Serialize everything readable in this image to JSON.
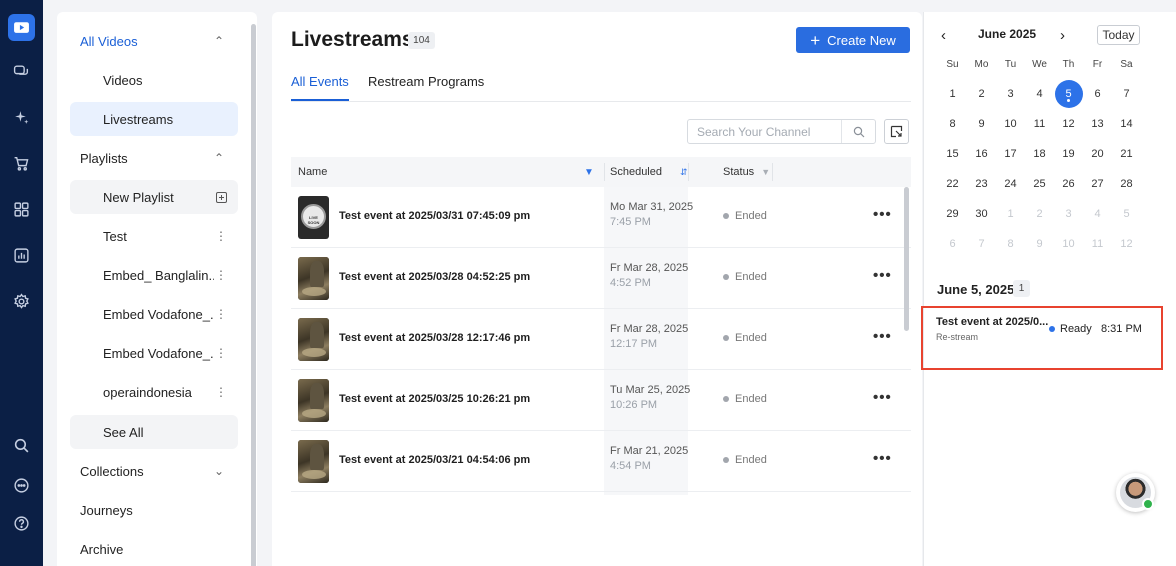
{
  "sidebar": {
    "sections": [
      {
        "label": "All Videos",
        "expanded": true
      },
      {
        "label": "Playlists",
        "expanded": true
      },
      {
        "label": "Collections",
        "expanded": false
      },
      {
        "label": "Journeys"
      },
      {
        "label": "Archive"
      }
    ],
    "video_items": [
      "Videos",
      "Livestreams"
    ],
    "playlist_items": [
      {
        "label": "New Playlist"
      },
      {
        "label": "Test"
      },
      {
        "label": "Embed_ Banglalin..."
      },
      {
        "label": "Embed Vodafone_..."
      },
      {
        "label": "Embed Vodafone_..."
      },
      {
        "label": "operaindonesia"
      },
      {
        "label": "See All"
      }
    ]
  },
  "main": {
    "title": "Livestreams",
    "count": "104",
    "create_label": "Create New",
    "tabs": [
      "All Events",
      "Restream Programs"
    ],
    "search_placeholder": "Search Your Channel",
    "columns": [
      "Name",
      "Scheduled",
      "Status"
    ],
    "rows": [
      {
        "name": "Test event at 2025/03/31 07:45:09 pm",
        "date": "Mo Mar 31, 2025",
        "time": "7:45 PM",
        "status": "Ended",
        "thumb": "live",
        "thumb_text": "LIVE SOON"
      },
      {
        "name": "Test event at 2025/03/28 04:52:25 pm",
        "date": "Fr Mar 28, 2025",
        "time": "4:52 PM",
        "status": "Ended",
        "thumb": "photo"
      },
      {
        "name": "Test event at 2025/03/28 12:17:46 pm",
        "date": "Fr Mar 28, 2025",
        "time": "12:17 PM",
        "status": "Ended",
        "thumb": "photo"
      },
      {
        "name": "Test event at 2025/03/25 10:26:21 pm",
        "date": "Tu Mar 25, 2025",
        "time": "10:26 PM",
        "status": "Ended",
        "thumb": "photo"
      },
      {
        "name": "Test event at 2025/03/21 04:54:06 pm",
        "date": "Fr Mar 21, 2025",
        "time": "4:54 PM",
        "status": "Ended",
        "thumb": "photo"
      }
    ]
  },
  "calendar": {
    "month": "June 2025",
    "today_label": "Today",
    "weekdays": [
      "Su",
      "Mo",
      "Tu",
      "We",
      "Th",
      "Fr",
      "Sa"
    ],
    "weeks": [
      [
        "1",
        "2",
        "3",
        "4",
        "5",
        "6",
        "7"
      ],
      [
        "8",
        "9",
        "10",
        "11",
        "12",
        "13",
        "14"
      ],
      [
        "15",
        "16",
        "17",
        "18",
        "19",
        "20",
        "21"
      ],
      [
        "22",
        "23",
        "24",
        "25",
        "26",
        "27",
        "28"
      ],
      [
        "29",
        "30",
        "1",
        "2",
        "3",
        "4",
        "5"
      ],
      [
        "6",
        "7",
        "8",
        "9",
        "10",
        "11",
        "12"
      ]
    ],
    "selected_day": "5",
    "selected_label": "June 5, 2025",
    "selected_count": "1",
    "event": {
      "title": "Test event at 2025/0...",
      "sub": "Re-stream",
      "status": "Ready",
      "time": "8:31 PM"
    }
  },
  "colors": {
    "accent": "#2d72e8",
    "rail": "#0b1f45",
    "highlight_border": "#e8432f",
    "ready_dot": "#2d72e8",
    "online": "#2fb24c"
  }
}
